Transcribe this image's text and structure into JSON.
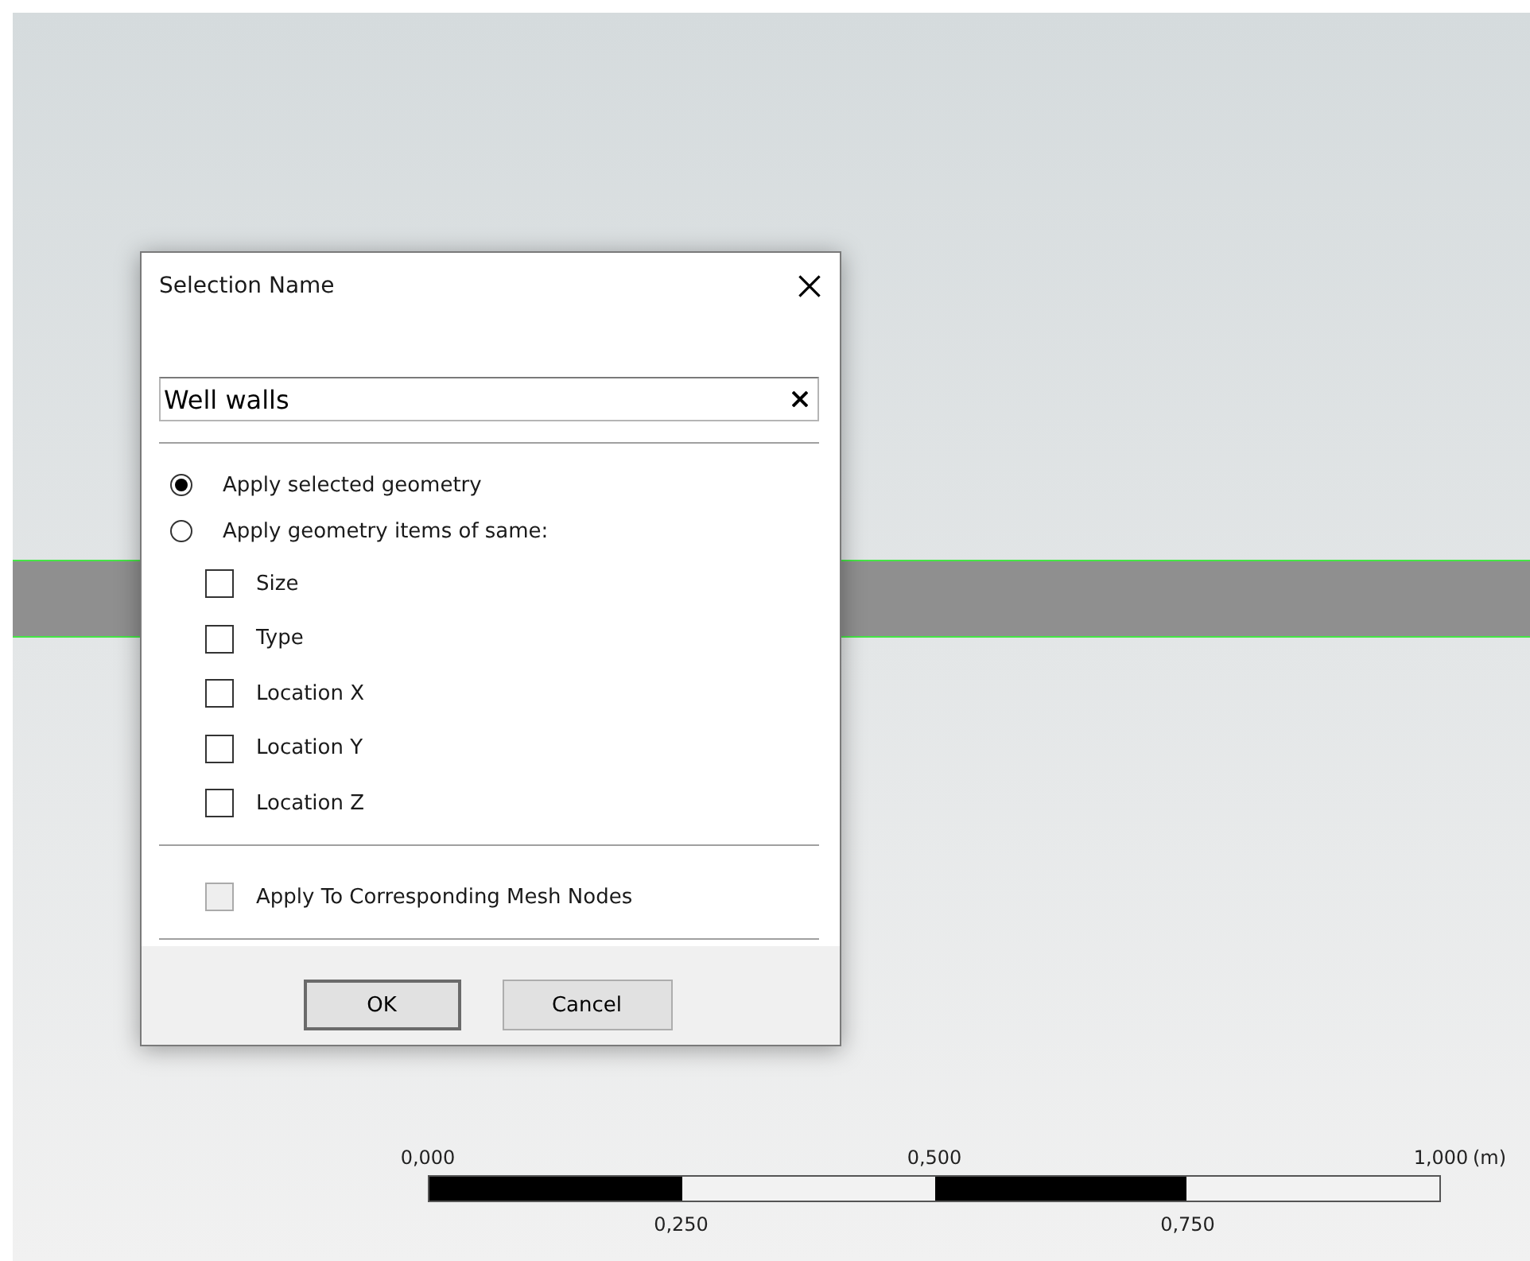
{
  "dialog": {
    "title": "Selection Name",
    "name_field": {
      "value": "Well walls"
    },
    "options": [
      {
        "label": "Apply selected geometry",
        "selected": true
      },
      {
        "label": "Apply geometry items of same:",
        "selected": false
      }
    ],
    "criteria": [
      {
        "label": "Size",
        "checked": false
      },
      {
        "label": "Type",
        "checked": false
      },
      {
        "label": "Location X",
        "checked": false
      },
      {
        "label": "Location Y",
        "checked": false
      },
      {
        "label": "Location Z",
        "checked": false
      }
    ],
    "mesh_nodes": {
      "label": "Apply To Corresponding Mesh Nodes",
      "checked": false,
      "disabled": true
    },
    "buttons": [
      {
        "label": "OK",
        "default": true
      },
      {
        "label": "Cancel",
        "default": false
      }
    ]
  },
  "scale_bar": {
    "top_labels": [
      "0,000",
      "0,500",
      "1,000"
    ],
    "bottom_labels": [
      "0,250",
      "0,750"
    ],
    "unit": "(m)"
  }
}
